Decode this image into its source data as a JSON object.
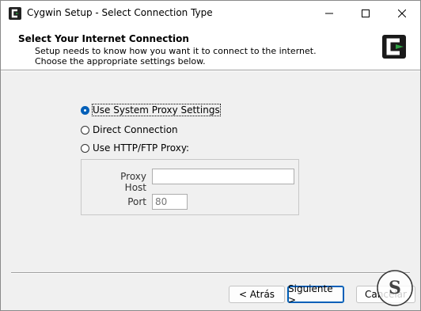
{
  "window": {
    "title": "Cygwin Setup - Select Connection Type"
  },
  "header": {
    "title": "Select Your Internet Connection",
    "description": "Setup needs to know how you want it to connect to the internet.  Choose the appropriate settings below."
  },
  "connection": {
    "selected": "system_proxy",
    "options": [
      {
        "label": "Use System Proxy Settings",
        "checked": true
      },
      {
        "label": "Direct Connection",
        "checked": false
      },
      {
        "label": "Use HTTP/FTP Proxy:",
        "checked": false
      }
    ]
  },
  "proxy": {
    "host_label": "Proxy Host",
    "host_value": "",
    "port_label": "Port",
    "port_value": "80"
  },
  "buttons": {
    "back": "< Atrás",
    "next": "Siguiente >",
    "cancel": "Cancelar"
  },
  "colors": {
    "accent": "#005fb8",
    "logo_green": "#2ea043",
    "logo_dark": "#1a1a1a"
  }
}
